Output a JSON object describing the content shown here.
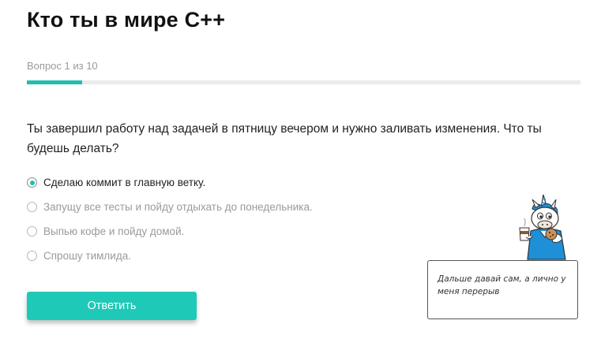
{
  "quiz": {
    "title": "Кто ты в мире C++",
    "progress_label": "Вопрос 1 из 10",
    "progress_fraction": 0.1,
    "question": "Ты завершил работу над задачей в пятницу вечером и нужно заливать изменения. Что ты будешь делать?",
    "options": [
      {
        "label": "Сделаю коммит в главную ветку.",
        "selected": true
      },
      {
        "label": "Запущу все тесты и пойду отдыхать до понедельника.",
        "selected": false
      },
      {
        "label": "Выпью кофе и пойду домой.",
        "selected": false
      },
      {
        "label": "Спрошу тимлида.",
        "selected": false
      }
    ],
    "submit_label": "Ответить"
  },
  "mascot": {
    "icon": "unicorn-mascot-icon",
    "speech": "Дальше давай сам, а лично у меня перерыв"
  },
  "colors": {
    "accent": "#1fc9b7",
    "progress_track": "#ebebeb"
  }
}
